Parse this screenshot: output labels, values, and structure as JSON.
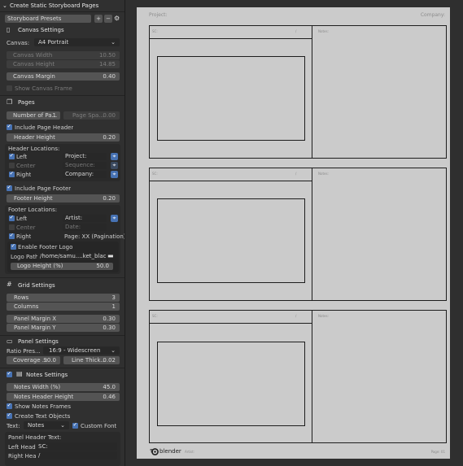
{
  "panel": {
    "title": "Create Static Storyboard Pages",
    "presets_label": "Storyboard Presets",
    "add_symbol": "+",
    "remove_symbol": "−",
    "canvas_settings": {
      "title": "Canvas Settings",
      "canvas_label": "Canvas:",
      "canvas_value": "A4 Portrait",
      "width_label": "Canvas Width",
      "width_value": "10.50",
      "height_label": "Canvas Height",
      "height_value": "14.85",
      "margin_label": "Canvas Margin",
      "margin_value": "0.40",
      "show_frame_label": "Show Canvas Frame"
    },
    "pages": {
      "title": "Pages",
      "num_pages_label": "Number of Pa...",
      "num_pages_value": "1",
      "page_spacing_label": "Page Spa...",
      "page_spacing_value": "0.00",
      "include_header_label": "Include Page Header",
      "header_height_label": "Header Height",
      "header_height_value": "0.20",
      "header_locations_label": "Header Locations:",
      "header_rows": [
        {
          "label": "Left",
          "value": "Project:",
          "enabled": true
        },
        {
          "label": "Center",
          "value": "Sequence:",
          "enabled": false
        },
        {
          "label": "Right",
          "value": "Company:",
          "enabled": true
        }
      ],
      "include_footer_label": "Include Page Footer",
      "footer_height_label": "Footer Height",
      "footer_height_value": "0.20",
      "footer_locations_label": "Footer Locations:",
      "footer_rows": [
        {
          "label": "Left",
          "value": "Artist:",
          "enabled": true
        },
        {
          "label": "Center",
          "value": "Date:",
          "enabled": false
        },
        {
          "label": "Right",
          "value": "Page: XX (Pagination)",
          "enabled": true
        }
      ],
      "enable_logo_label": "Enable Footer Logo",
      "logo_path_label": "Logo Path:",
      "logo_path_value": "/home/samu....ket_black.png",
      "logo_height_label": "Logo Height (%)",
      "logo_height_value": "50.0"
    },
    "grid_settings": {
      "title": "Grid Settings",
      "rows_label": "Rows",
      "rows_value": "3",
      "columns_label": "Columns",
      "columns_value": "1",
      "margin_x_label": "Panel Margin X",
      "margin_x_value": "0.30",
      "margin_y_label": "Panel Margin Y",
      "margin_y_value": "0.30"
    },
    "panel_settings": {
      "title": "Panel Settings",
      "ratio_label": "Ratio Pres...",
      "ratio_value": "16:9 - Widescreen",
      "coverage_label": "Coverage ...",
      "coverage_value": "90.0",
      "line_thick_label": "Line Thick...",
      "line_thick_value": "0.02"
    },
    "notes_settings": {
      "title": "Notes Settings",
      "notes_width_label": "Notes Width (%)",
      "notes_width_value": "45.0",
      "notes_header_label": "Notes Header Height",
      "notes_header_value": "0.46",
      "show_frames_label": "Show Notes Frames",
      "create_text_label": "Create Text Objects",
      "text_label": "Text:",
      "text_value": "Notes",
      "custom_font_label": "Custom Font",
      "panel_header_text_label": "Panel Header Text:",
      "left_head_label": "Left Head...",
      "left_head_value": "SC:",
      "right_head_label": "Right Hea...",
      "right_head_value": "/"
    }
  },
  "page": {
    "header_left": "Project:",
    "header_right": "Company:",
    "panel_sc_label": "SC:",
    "panel_slash": "/",
    "notes_label": "Notes:",
    "footer_logo_text": "blender",
    "footer_artist": "Artist:",
    "footer_page": "Page: 01"
  }
}
